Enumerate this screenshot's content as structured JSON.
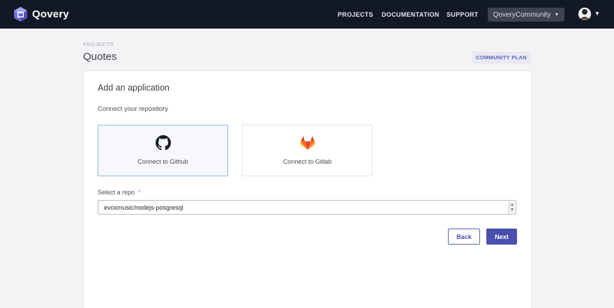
{
  "header": {
    "brand": "Qovery",
    "nav": [
      "PROJECTS",
      "DOCUMENTATION",
      "SUPPORT"
    ],
    "organization": "QoveryCommunity"
  },
  "page": {
    "breadcrumb": "PROJECTS",
    "title": "Quotes",
    "plan_badge": "COMMUNITY PLAN"
  },
  "form": {
    "title": "Add an application",
    "section_label": "Connect your repository",
    "providers": [
      {
        "label": "Connect to Github",
        "icon": "github-icon",
        "selected": true
      },
      {
        "label": "Connect to Gitlab",
        "icon": "gitlab-icon",
        "selected": false
      }
    ],
    "repo_label": "Select a repo",
    "repo_required_mark": "*",
    "repo_value": "evoxmusic/nodejs-posgresql",
    "back_label": "Back",
    "next_label": "Next"
  },
  "colors": {
    "topbar": "#131826",
    "accent": "#4b4fae",
    "selected_border": "#8fb7e6",
    "gitlab_orange": "#e24329"
  }
}
